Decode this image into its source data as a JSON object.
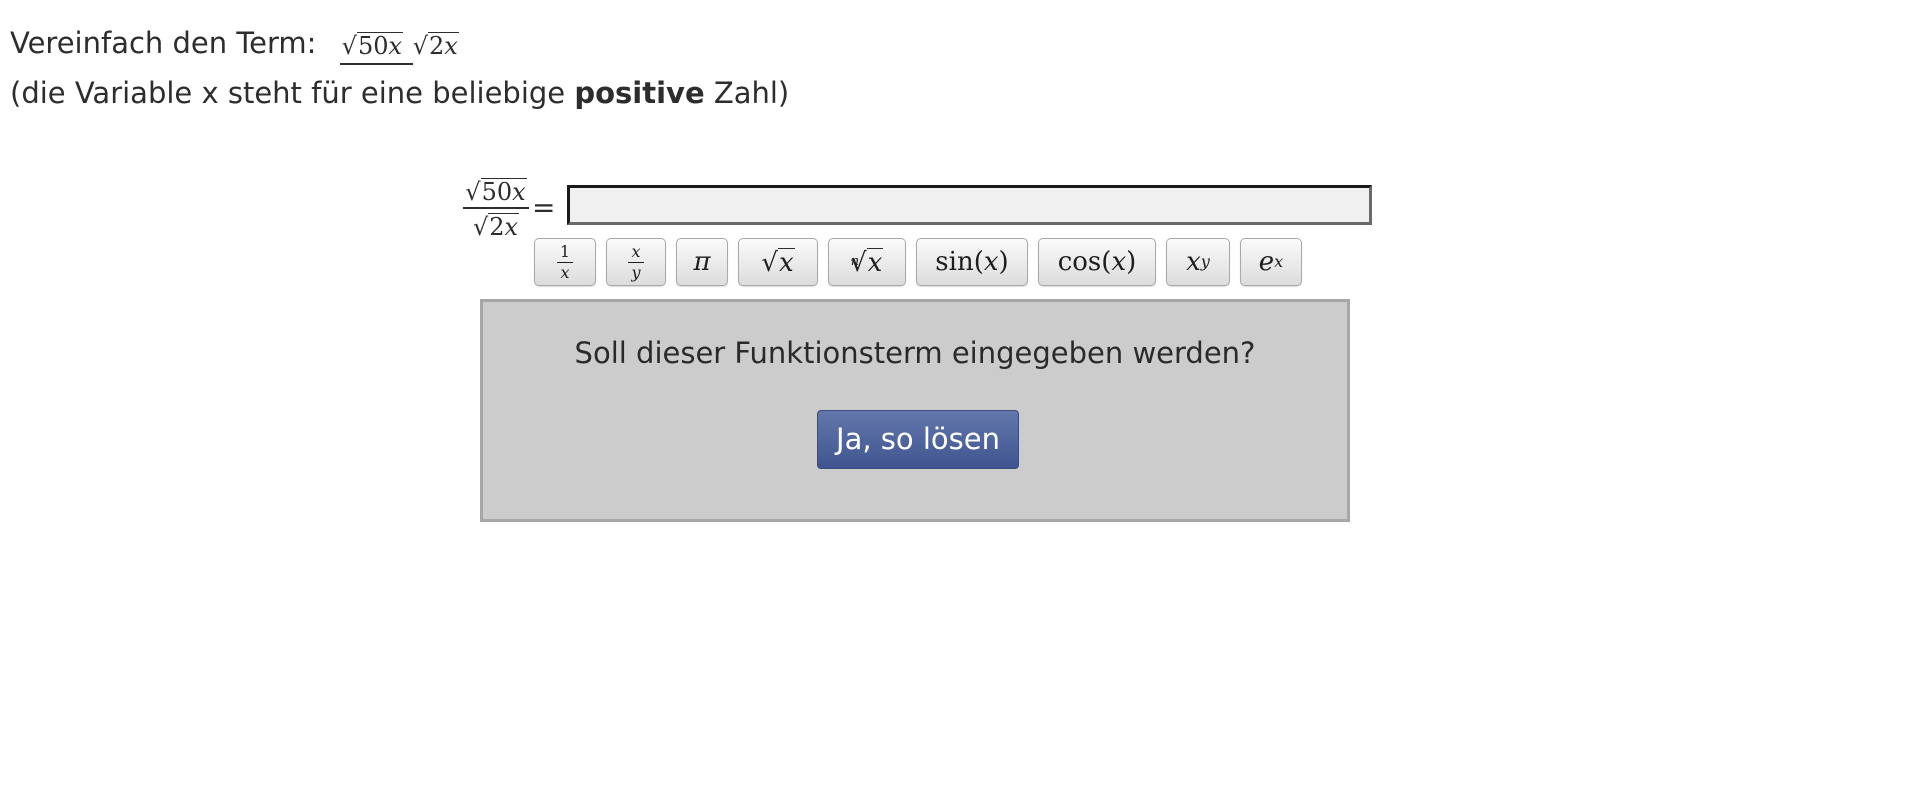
{
  "task": {
    "prompt": "Vereinfach den Term:",
    "hint_before": "(die Variable x steht für eine beliebige ",
    "hint_bold": "positive",
    "hint_after": " Zahl)"
  },
  "expression": {
    "numerator_radicand_coeff": "50",
    "numerator_radicand_var": "x",
    "denominator_radicand_coeff": "2",
    "denominator_radicand_var": "x"
  },
  "equation": {
    "equals": "=",
    "answer_value": ""
  },
  "keypad": {
    "reciprocal": {
      "num": "1",
      "den": "x"
    },
    "fraction": {
      "num": "x",
      "den": "y"
    },
    "pi": "π",
    "sqrt_var": "x",
    "nthroot_index": "n",
    "nthroot_var": "x",
    "sin_fn": "sin",
    "sin_arg": "x",
    "cos_fn": "cos",
    "cos_arg": "x",
    "power_base": "x",
    "power_exp": "y",
    "exp_base": "e",
    "exp_exp": "x"
  },
  "confirm": {
    "question": "Soll dieser Funktionsterm eingegeben werden?",
    "button_label": "Ja, so lösen"
  },
  "colors": {
    "button_top": "#6377ac",
    "button_bottom": "#40558f",
    "panel_bg": "#cccccc",
    "input_bg": "#f0f0f0"
  }
}
